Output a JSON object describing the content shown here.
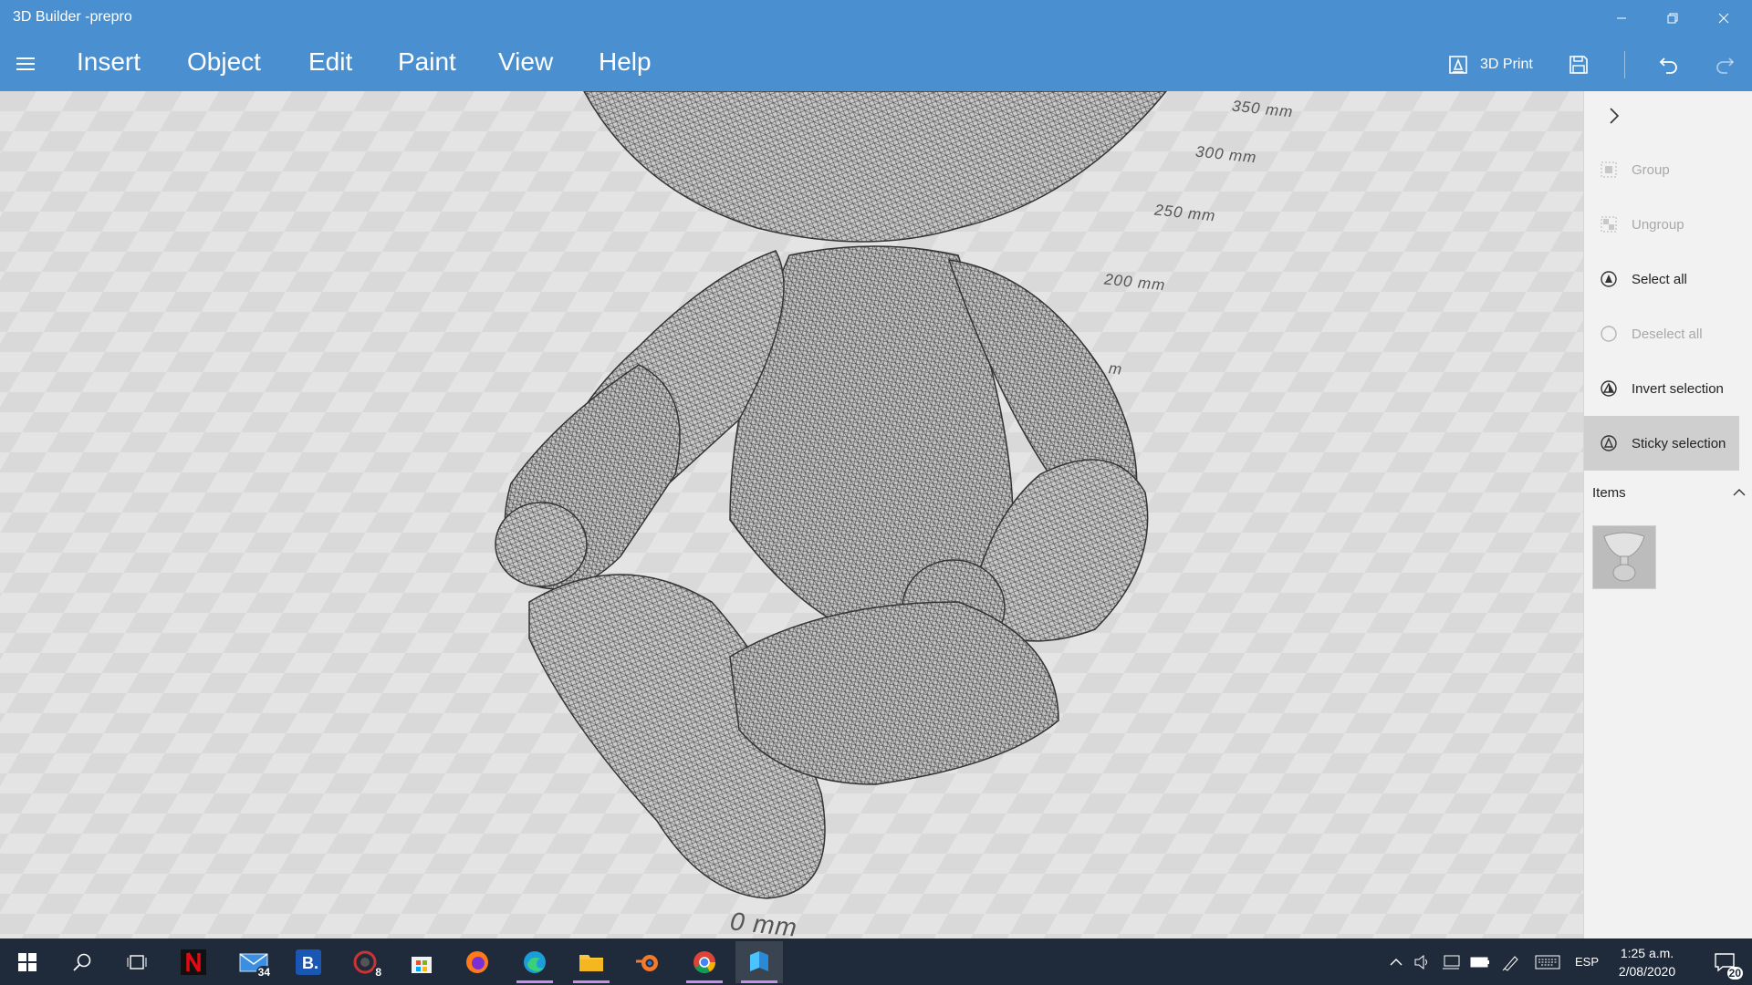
{
  "window": {
    "title": "3D Builder -prepro"
  },
  "menu": {
    "items": [
      "Insert",
      "Object",
      "Edit",
      "Paint",
      "View",
      "Help"
    ]
  },
  "toolbar": {
    "print_label": "3D Print"
  },
  "viewport": {
    "ruler": [
      "350 mm",
      "300 mm",
      "250 mm",
      "200 mm",
      "m",
      "0 mm"
    ]
  },
  "panel": {
    "actions": [
      {
        "label": "Group",
        "icon": "group-icon",
        "state": "disabled"
      },
      {
        "label": "Ungroup",
        "icon": "ungroup-icon",
        "state": "disabled"
      },
      {
        "label": "Select all",
        "icon": "select-all-icon",
        "state": "enabled"
      },
      {
        "label": "Deselect all",
        "icon": "deselect-all-icon",
        "state": "disabled"
      },
      {
        "label": "Invert selection",
        "icon": "invert-selection-icon",
        "state": "enabled"
      },
      {
        "label": "Sticky selection",
        "icon": "sticky-selection-icon",
        "state": "active"
      }
    ],
    "items_header": "Items"
  },
  "taskbar": {
    "apps": [
      "start",
      "search",
      "task-view",
      "netflix",
      "mail",
      "booking",
      "game",
      "store",
      "firefox",
      "edge",
      "file-explorer",
      "blender",
      "chrome",
      "3d-builder"
    ],
    "mail_badge": "34",
    "game_badge": "8",
    "language": "ESP",
    "time": "1:25 a.m.",
    "date": "2/08/2020",
    "notifications": "20"
  },
  "colors": {
    "accent": "#4a90d0",
    "taskbar": "#1f2b3a",
    "panel": "#f2f2f2",
    "active_row": "#cfcfcf"
  }
}
